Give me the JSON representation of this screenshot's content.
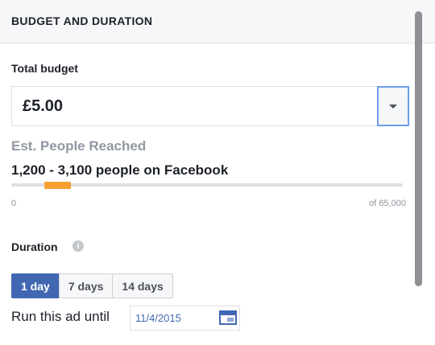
{
  "panel": {
    "title": "BUDGET AND DURATION"
  },
  "budget": {
    "label": "Total budget",
    "value": "£5.00",
    "dropdown_icon": "chevron-down-icon"
  },
  "reach": {
    "title": "Est. People Reached",
    "range_text": "1,200 - 3,100 people on Facebook",
    "min_label": "0",
    "max_label": "of 65,000",
    "range_low": 1200,
    "range_high": 3100,
    "total": 65000,
    "marker_color": "#f7a032"
  },
  "duration": {
    "label": "Duration",
    "info_icon": "info-icon",
    "options": [
      "1 day",
      "7 days",
      "14 days"
    ],
    "selected": "1 day",
    "run_until_label": "Run this ad until",
    "end_date": "11/4/2015",
    "calendar_icon": "calendar-icon"
  },
  "colors": {
    "accent": "#4267b2",
    "focus_border": "#6d9ee8"
  }
}
